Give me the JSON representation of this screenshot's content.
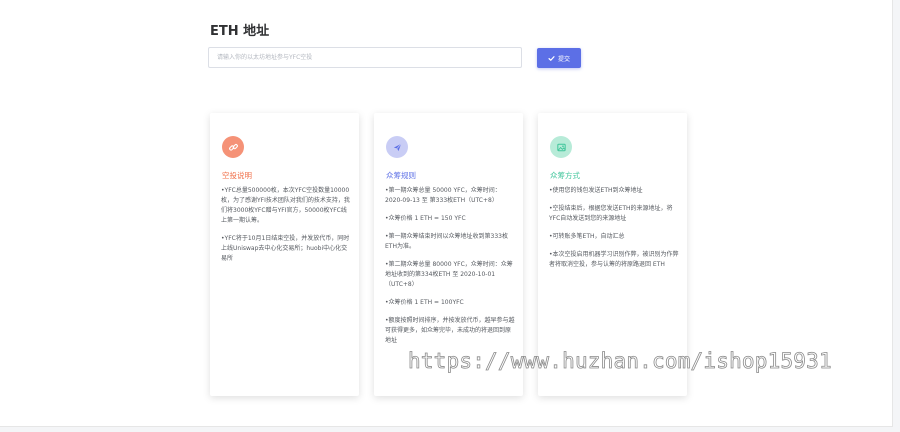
{
  "header": {
    "title": "ETH 地址"
  },
  "search": {
    "placeholder": "请输入你的以太坊地址参与YFC空投",
    "value": ""
  },
  "submit": {
    "label": "提交",
    "icon": "check-icon"
  },
  "colors": {
    "accent": "#5c6fe6",
    "orange": "#f0704a",
    "blue": "#5c6fe6",
    "green": "#3ec59a"
  },
  "cards": [
    {
      "title": "空投说明",
      "icon": "link-icon",
      "items": [
        "YFC总量500000枚，本次YFC空投数量10000枚，为了感谢YFI技术团队对我们的技术支持，我们将3000枚YFC赠与YFI官方，50000枚YFC线上第一期认筹。",
        "YFC将于10月1日结束空投，并发放代币，同时上线Uniswap去中心化交易所；huobi中心化交易所"
      ]
    },
    {
      "title": "众筹规则",
      "icon": "send-icon",
      "items": [
        "第一期众筹总量 50000 YFC，众筹时间：2020-09-13 至 第333枚ETH（UTC+8）",
        "众筹价格 1 ETH = 150 YFC",
        "第一期众筹结束时间以众筹地址收到第333枚ETH为准。",
        "第二期众筹总量 80000 YFC，众筹时间：众筹地址收到的第334枚ETH 至 2020-10-01（UTC+8）",
        "众筹价格 1 ETH = 100YFC",
        "额度按照时间排序，并按发放代币，越早参与越可获得更多，如众筹完毕，未成功的将退回到原地址"
      ]
    },
    {
      "title": "众筹方式",
      "icon": "image-icon",
      "items": [
        "使用您的钱包发送ETH到众筹地址",
        "空投结束后，根据您发送ETH的来源地址，将YFC自动发送到您的来源地址",
        "可转账多笔ETH，自动汇总",
        "本次空投启用机器学习识别作弊，被识别为作弊者将取消空投，参与认筹的将原路退回 ETH"
      ]
    }
  ],
  "watermark": "https://www.huzhan.com/ishop15931"
}
